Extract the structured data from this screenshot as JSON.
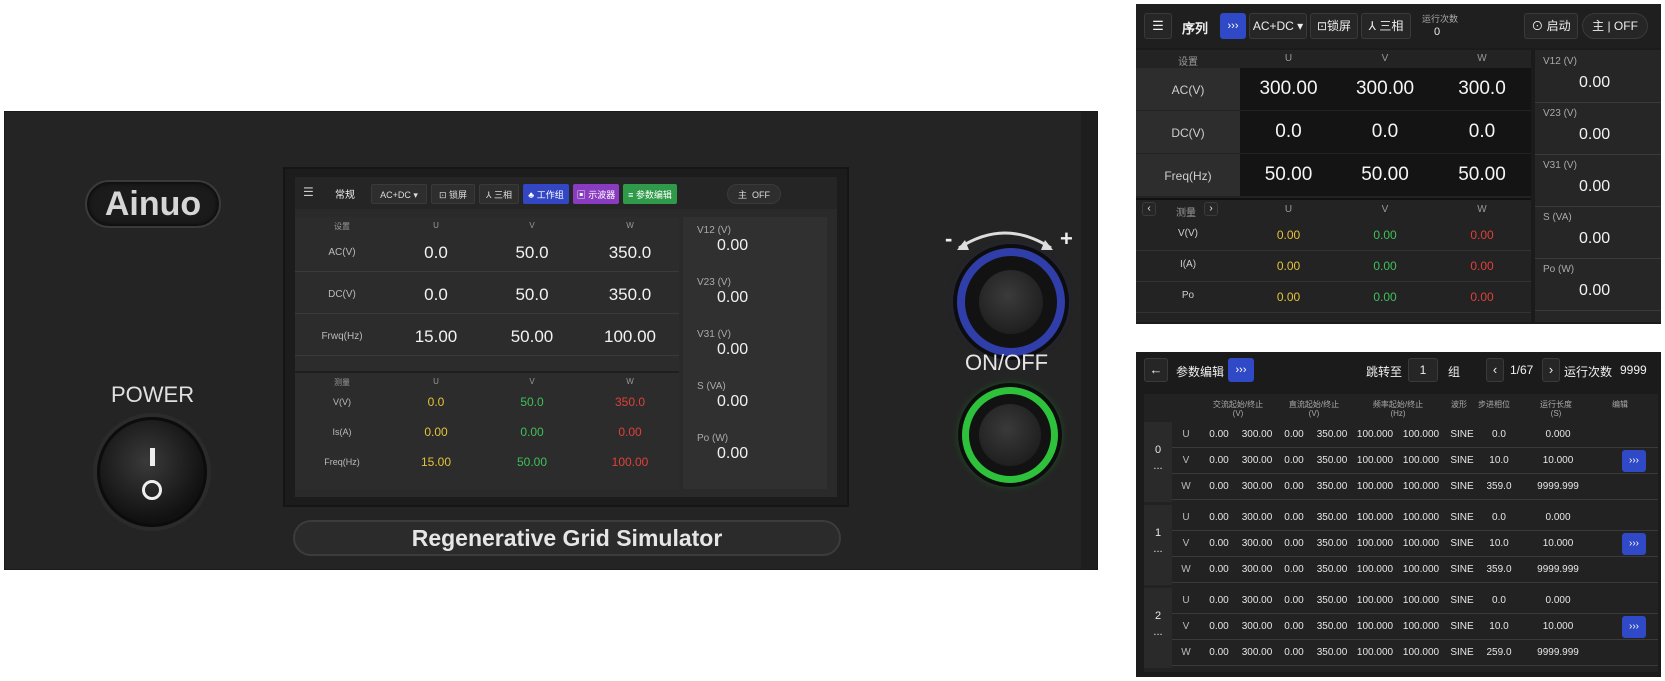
{
  "device": {
    "logo": "Ainuo",
    "power_label": "POWER",
    "onoff_label": "ON/OFF",
    "name_plate": "Regenerative Grid Simulator",
    "knob_minus": "-",
    "knob_plus": "+",
    "screen": {
      "toolbar": {
        "menu_icon": "menu-icon",
        "mode": "常规",
        "coupling": "AC+DC ▾",
        "lock": "锁屏",
        "phase": "三相",
        "workgroup": "工作组",
        "oscilloscope": "示波器",
        "param_edit": "参数编辑",
        "master": "主",
        "output": "OFF"
      },
      "set_header": [
        "设置",
        "U",
        "V",
        "W"
      ],
      "set_rows": [
        {
          "label": "AC(V)",
          "values": [
            "0.0",
            "50.0",
            "350.0"
          ]
        },
        {
          "label": "DC(V)",
          "values": [
            "0.0",
            "50.0",
            "350.0"
          ]
        },
        {
          "label": "Frwq(Hz)",
          "values": [
            "15.00",
            "50.00",
            "100.00"
          ]
        }
      ],
      "meas_header": [
        "测量",
        "U",
        "V",
        "W"
      ],
      "meas_rows": [
        {
          "label": "V(V)",
          "values": [
            "0.0",
            "50.0",
            "350.0"
          ]
        },
        {
          "label": "Is(A)",
          "values": [
            "0.00",
            "0.00",
            "0.00"
          ]
        },
        {
          "label": "Freq(Hz)",
          "values": [
            "15.00",
            "50.00",
            "100.00"
          ]
        }
      ],
      "side": [
        {
          "label": "V12 (V)",
          "value": "0.00"
        },
        {
          "label": "V23 (V)",
          "value": "0.00"
        },
        {
          "label": "V31 (V)",
          "value": "0.00"
        },
        {
          "label": "S (VA)",
          "value": "0.00"
        },
        {
          "label": "Po (W)",
          "value": "0.00"
        }
      ]
    }
  },
  "panel_a": {
    "toolbar": {
      "menu_icon": "menu-icon",
      "mode": "序列",
      "arrow_btn": "›››",
      "coupling": "AC+DC ▾",
      "lock": "锁屏",
      "phase": "三相",
      "run_count_label": "运行次数",
      "run_count_value": "0",
      "start": "启动",
      "master": "主",
      "output": "OFF"
    },
    "set_header": [
      "设置",
      "U",
      "V",
      "W"
    ],
    "set_rows": [
      {
        "label": "AC(V)",
        "values": [
          "300.00",
          "300.00",
          "300.0"
        ]
      },
      {
        "label": "DC(V)",
        "values": [
          "0.0",
          "0.0",
          "0.0"
        ]
      },
      {
        "label": "Freq(Hz)",
        "values": [
          "50.00",
          "50.00",
          "50.00"
        ]
      }
    ],
    "meas_header": [
      "测量",
      "U",
      "V",
      "W"
    ],
    "meas_rows": [
      {
        "label": "V(V)",
        "values": [
          "0.00",
          "0.00",
          "0.00"
        ]
      },
      {
        "label": "I(A)",
        "values": [
          "0.00",
          "0.00",
          "0.00"
        ]
      },
      {
        "label": "Po",
        "values": [
          "0.00",
          "0.00",
          "0.00"
        ]
      }
    ],
    "side": [
      {
        "label": "V12 (V)",
        "value": "0.00"
      },
      {
        "label": "V23 (V)",
        "value": "0.00"
      },
      {
        "label": "V31 (V)",
        "value": "0.00"
      },
      {
        "label": "S (VA)",
        "value": "0.00"
      },
      {
        "label": "Po (W)",
        "value": "0.00"
      }
    ]
  },
  "panel_b": {
    "toolbar": {
      "back": "←",
      "title": "参数编辑",
      "arrow_btn": "›››",
      "jump_label": "跳转至",
      "jump_value": "1",
      "group_label": "组",
      "prev": "‹",
      "page": "1/67",
      "next": "›",
      "run_count_label": "运行次数",
      "run_count_value": "9999"
    },
    "headers": [
      "交流起始/终止\n(V)",
      "直流起始/终止\n(V)",
      "频率起始/终止\n(Hz)",
      "波形",
      "步进相位",
      "运行长度\n(S)",
      "编辑"
    ],
    "groups": [
      {
        "id": "0",
        "more": "...",
        "rows": [
          {
            "phase": "U",
            "cells": [
              "0.00",
              "300.00",
              "0.00",
              "350.00",
              "100.000",
              "100.000",
              "SINE",
              "0.0",
              "0.000"
            ]
          },
          {
            "phase": "V",
            "cells": [
              "0.00",
              "300.00",
              "0.00",
              "350.00",
              "100.000",
              "100.000",
              "SINE",
              "10.0",
              "10.000"
            ]
          },
          {
            "phase": "W",
            "cells": [
              "0.00",
              "300.00",
              "0.00",
              "350.00",
              "100.000",
              "100.000",
              "SINE",
              "359.0",
              "9999.999"
            ]
          }
        ]
      },
      {
        "id": "1",
        "more": "...",
        "rows": [
          {
            "phase": "U",
            "cells": [
              "0.00",
              "300.00",
              "0.00",
              "350.00",
              "100.000",
              "100.000",
              "SINE",
              "0.0",
              "0.000"
            ]
          },
          {
            "phase": "V",
            "cells": [
              "0.00",
              "300.00",
              "0.00",
              "350.00",
              "100.000",
              "100.000",
              "SINE",
              "10.0",
              "10.000"
            ]
          },
          {
            "phase": "W",
            "cells": [
              "0.00",
              "300.00",
              "0.00",
              "350.00",
              "100.000",
              "100.000",
              "SINE",
              "359.0",
              "9999.999"
            ]
          }
        ]
      },
      {
        "id": "2",
        "more": "...",
        "rows": [
          {
            "phase": "U",
            "cells": [
              "0.00",
              "300.00",
              "0.00",
              "350.00",
              "100.000",
              "100.000",
              "SINE",
              "0.0",
              "0.000"
            ]
          },
          {
            "phase": "V",
            "cells": [
              "0.00",
              "300.00",
              "0.00",
              "350.00",
              "100.000",
              "100.000",
              "SINE",
              "10.0",
              "10.000"
            ]
          },
          {
            "phase": "W",
            "cells": [
              "0.00",
              "300.00",
              "0.00",
              "350.00",
              "100.000",
              "100.000",
              "SINE",
              "259.0",
              "9999.999"
            ]
          }
        ]
      }
    ],
    "edit_btn": "›››"
  },
  "colors": {
    "u_phase": "#e3c33a",
    "v_phase": "#3fc05a",
    "w_phase": "#e0403a",
    "accent_blue": "#2f49c7",
    "knob_ring": "#2f3ea8",
    "onoff_ring": "#2ec23c"
  }
}
